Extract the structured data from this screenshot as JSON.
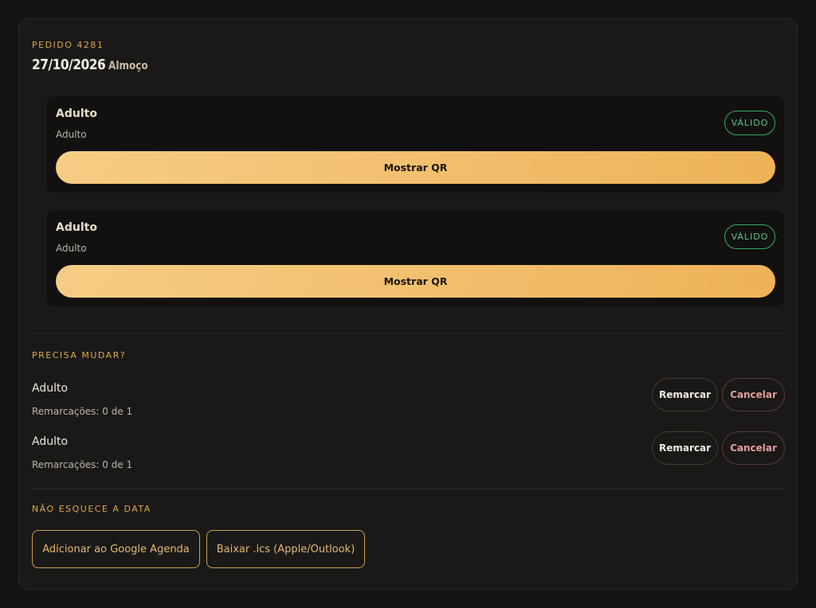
{
  "order": {
    "label": "PEDIDO 4281",
    "date": "27/10/2026",
    "separator": "·",
    "meal": "Almoço"
  },
  "tickets": [
    {
      "name": "Adulto",
      "type": "Adulto",
      "status": "VÁLIDO",
      "qr_label": "Mostrar QR"
    },
    {
      "name": "Adulto",
      "type": "Adulto",
      "status": "VÁLIDO",
      "qr_label": "Mostrar QR"
    }
  ],
  "changes": {
    "label": "PRECISA MUDAR?",
    "items": [
      {
        "name": "Adulto",
        "reschedules": "Remarcações: 0 de 1",
        "reschedule_label": "Remarcar",
        "cancel_label": "Cancelar"
      },
      {
        "name": "Adulto",
        "reschedules": "Remarcações: 0 de 1",
        "reschedule_label": "Remarcar",
        "cancel_label": "Cancelar"
      }
    ]
  },
  "calendar": {
    "label": "NÃO ESQUECE A DATA",
    "google_label": "Adicionar ao Google Agenda",
    "ics_label": "Baixar .ics (Apple/Outlook)"
  },
  "colors": {
    "accent": "#e0a64b",
    "valid": "#5cc281",
    "cancel": "#e49e97",
    "background": "#141414",
    "card": "#1a1918"
  }
}
